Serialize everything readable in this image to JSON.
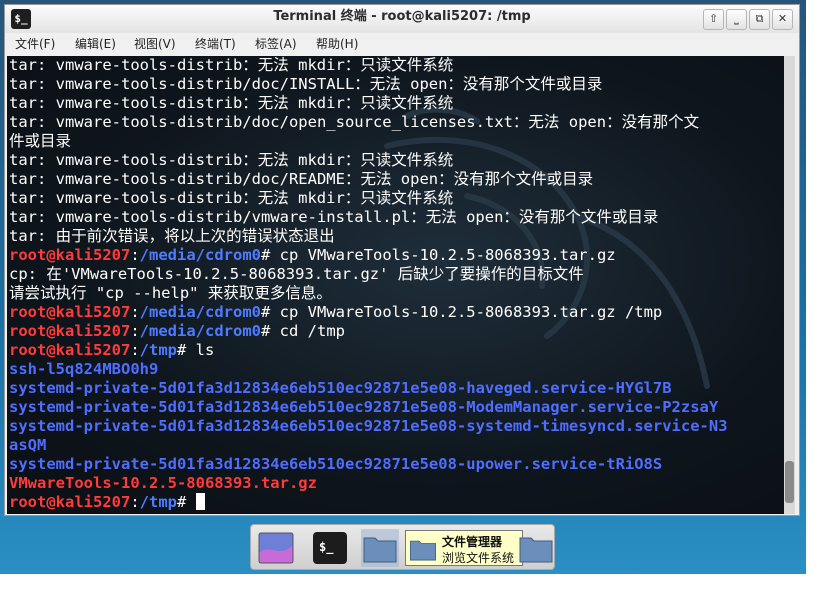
{
  "window": {
    "title": "Terminal 终端 - root@kali5207: /tmp",
    "buttons": {
      "up": "⇧",
      "minimize": "⎵",
      "maximize": "⧉",
      "close": "✕"
    }
  },
  "menubar": [
    {
      "label": "文件(F)"
    },
    {
      "label": "编辑(E)"
    },
    {
      "label": "视图(V)"
    },
    {
      "label": "终端(T)"
    },
    {
      "label": "标签(A)"
    },
    {
      "label": "帮助(H)"
    }
  ],
  "terminal": {
    "lines": [
      {
        "type": "text",
        "text": "tar: vmware-tools-distrib：无法 mkdir：只读文件系统"
      },
      {
        "type": "text",
        "text": "tar: vmware-tools-distrib/doc/INSTALL：无法 open：没有那个文件或目录"
      },
      {
        "type": "text",
        "text": "tar: vmware-tools-distrib：无法 mkdir：只读文件系统"
      },
      {
        "type": "text",
        "text": "tar: vmware-tools-distrib/doc/open_source_licenses.txt：无法 open：没有那个文"
      },
      {
        "type": "text",
        "text": "件或目录"
      },
      {
        "type": "text",
        "text": "tar: vmware-tools-distrib：无法 mkdir：只读文件系统"
      },
      {
        "type": "text",
        "text": "tar: vmware-tools-distrib/doc/README：无法 open：没有那个文件或目录"
      },
      {
        "type": "text",
        "text": "tar: vmware-tools-distrib：无法 mkdir：只读文件系统"
      },
      {
        "type": "text",
        "text": "tar: vmware-tools-distrib/vmware-install.pl：无法 open：没有那个文件或目录"
      },
      {
        "type": "text",
        "text": "tar: 由于前次错误，将以上次的错误状态退出"
      },
      {
        "type": "prompt",
        "user": "root@kali5207",
        "sep": ":",
        "path": "/media/cdrom0",
        "cmd": "# cp VMwareTools-10.2.5-8068393.tar.gz"
      },
      {
        "type": "text",
        "text": "cp: 在'VMwareTools-10.2.5-8068393.tar.gz' 后缺少了要操作的目标文件"
      },
      {
        "type": "text",
        "text": "请尝试执行 \"cp --help\" 来获取更多信息。"
      },
      {
        "type": "prompt",
        "user": "root@kali5207",
        "sep": ":",
        "path": "/media/cdrom0",
        "cmd": "# cp VMwareTools-10.2.5-8068393.tar.gz /tmp"
      },
      {
        "type": "prompt",
        "user": "root@kali5207",
        "sep": ":",
        "path": "/media/cdrom0",
        "cmd": "# cd /tmp"
      },
      {
        "type": "prompt",
        "user": "root@kali5207",
        "sep": ":",
        "path": "/tmp",
        "cmd": "# ls"
      },
      {
        "type": "dir",
        "text": "ssh-l5q824MBO0h9"
      },
      {
        "type": "dir",
        "text": "systemd-private-5d01fa3d12834e6eb510ec92871e5e08-haveged.service-HYGl7B"
      },
      {
        "type": "dir",
        "text": "systemd-private-5d01fa3d12834e6eb510ec92871e5e08-ModemManager.service-P2zsaY"
      },
      {
        "type": "dir",
        "text": "systemd-private-5d01fa3d12834e6eb510ec92871e5e08-systemd-timesyncd.service-N3"
      },
      {
        "type": "dir",
        "text": "asQM"
      },
      {
        "type": "dir",
        "text": "systemd-private-5d01fa3d12834e6eb510ec92871e5e08-upower.service-tRiO8S"
      },
      {
        "type": "archive",
        "text": "VMwareTools-10.2.5-8068393.tar.gz"
      },
      {
        "type": "prompt_cursor",
        "user": "root@kali5207",
        "sep": ":",
        "path": "/tmp",
        "cmd": "# "
      }
    ]
  },
  "taskbar": {
    "items": [
      {
        "name": "desktop-icon"
      },
      {
        "name": "terminal-icon"
      },
      {
        "name": "folder-icon"
      },
      {
        "name": "file-manager-icon"
      },
      {
        "name": "folder-icon-2"
      }
    ],
    "tooltip": {
      "title": "文件管理器",
      "subtitle": "浏览文件系统"
    }
  },
  "colors": {
    "prompt_user": "#ff3b3b",
    "prompt_path": "#4f7cff",
    "directory": "#4f6dff",
    "archive": "#ff3b3b",
    "terminal_bg": "#0e151c"
  }
}
